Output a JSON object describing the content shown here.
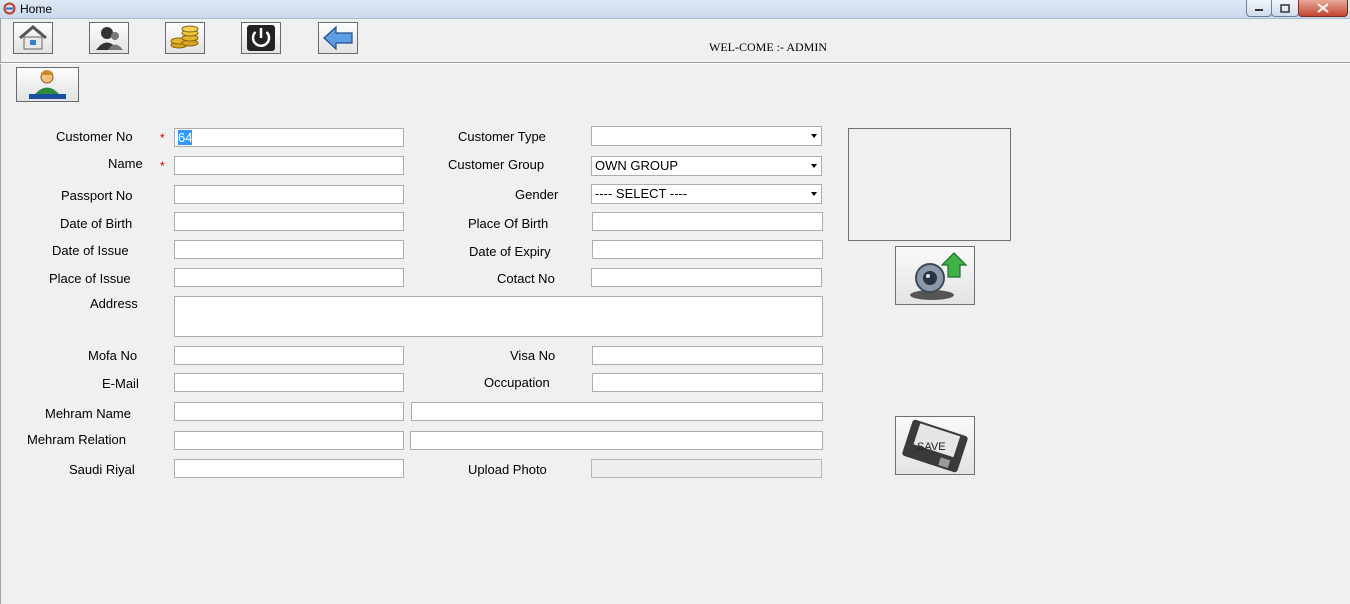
{
  "window": {
    "title": "Home"
  },
  "header": {
    "welcome": "WEL-COME :- ADMIN"
  },
  "toolbar": [
    {
      "name": "home-icon"
    },
    {
      "name": "user-icon"
    },
    {
      "name": "coins-icon"
    },
    {
      "name": "power-icon"
    },
    {
      "name": "back-arrow-icon"
    }
  ],
  "form": {
    "customer_no": {
      "label": "Customer No",
      "value": "64"
    },
    "name": {
      "label": "Name",
      "value": ""
    },
    "passport_no": {
      "label": "Passport No",
      "value": ""
    },
    "dob": {
      "label": "Date of Birth",
      "value": ""
    },
    "doi": {
      "label": "Date of Issue",
      "value": ""
    },
    "poi": {
      "label": "Place of Issue",
      "value": ""
    },
    "address": {
      "label": "Address",
      "value": ""
    },
    "mofa_no": {
      "label": "Mofa No",
      "value": ""
    },
    "email": {
      "label": "E-Mail",
      "value": ""
    },
    "mehram_name": {
      "label": "Mehram Name",
      "value": "",
      "value2": ""
    },
    "mehram_relation": {
      "label": "Mehram Relation",
      "value": "",
      "value2": ""
    },
    "saudi_riyal": {
      "label": "Saudi Riyal",
      "value": ""
    },
    "customer_type": {
      "label": "Customer Type",
      "value": ""
    },
    "customer_group": {
      "label": "Customer Group",
      "value": "OWN GROUP"
    },
    "gender": {
      "label": "Gender",
      "value": "---- SELECT ----"
    },
    "pob": {
      "label": "Place Of Birth",
      "value": ""
    },
    "doe": {
      "label": "Date of Expiry",
      "value": ""
    },
    "contact_no": {
      "label": "Cotact No",
      "value": ""
    },
    "visa_no": {
      "label": "Visa No",
      "value": ""
    },
    "occupation": {
      "label": "Occupation",
      "value": ""
    },
    "upload_photo": {
      "label": "Upload Photo",
      "value": ""
    },
    "required_mark": "*"
  },
  "buttons": {
    "save": "SAVE"
  },
  "colors": {
    "required": "#d00000",
    "selection": "#3399ff"
  }
}
